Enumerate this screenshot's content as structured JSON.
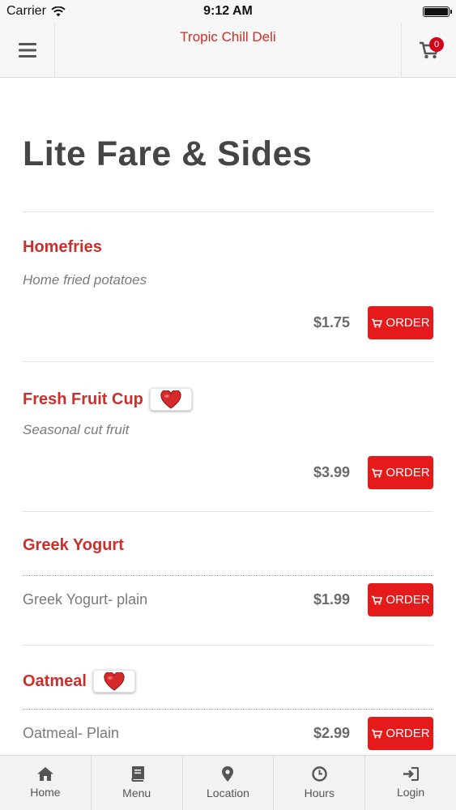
{
  "status": {
    "carrier": "Carrier",
    "time": "9:12 AM"
  },
  "header": {
    "title": "Tropic Chill Deli",
    "cart_count": "0"
  },
  "page": {
    "title": "Lite Fare & Sides"
  },
  "menu_items": [
    {
      "name": "Homefries",
      "description": "Home fried potatoes",
      "price": "$1.75",
      "order_label": "ORDER",
      "favorite": false
    },
    {
      "name": "Fresh Fruit Cup",
      "description": "Seasonal cut fruit",
      "price": "$3.99",
      "order_label": "ORDER",
      "favorite": true
    },
    {
      "name": "Greek Yogurt",
      "variant": "Greek Yogurt- plain",
      "price": "$1.99",
      "order_label": "ORDER",
      "favorite": false
    },
    {
      "name": "Oatmeal",
      "variant": "Oatmeal- Plain",
      "price": "$2.99",
      "order_label": "ORDER",
      "favorite": true
    }
  ],
  "bottom_nav": [
    {
      "label": "Home",
      "icon": "home-icon"
    },
    {
      "label": "Menu",
      "icon": "book-icon"
    },
    {
      "label": "Location",
      "icon": "map-pin-icon"
    },
    {
      "label": "Hours",
      "icon": "clock-icon"
    },
    {
      "label": "Login",
      "icon": "login-icon"
    }
  ],
  "colors": {
    "accent": "#c9302c",
    "order_button": "#e51b1b",
    "badge": "#d0021b"
  }
}
